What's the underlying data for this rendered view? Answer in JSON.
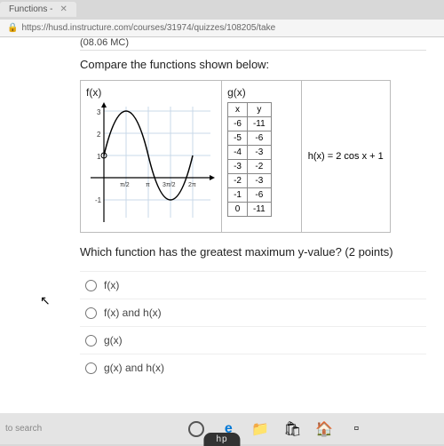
{
  "tab": {
    "title": "Functions - ",
    "close": "✕"
  },
  "urlbar": {
    "lock": "🔒",
    "url": "https://husd.instructure.com/courses/31974/quizzes/108205/take"
  },
  "question_code": "(08.06 MC)",
  "prompt": "Compare the functions shown below:",
  "columns": {
    "fx_label": "f(x)",
    "gx_label": "g(x)",
    "hx_label": "h(x) = 2 cos x + 1"
  },
  "chart_data": {
    "type": "line",
    "title": "",
    "xlabel": "",
    "ylabel": "",
    "xlim": [
      -0.6,
      6.8
    ],
    "ylim": [
      -1.5,
      3.5
    ],
    "xticks": [
      "π/2",
      "π",
      "3π/2",
      "2π"
    ],
    "yticks": [
      1,
      2,
      3
    ],
    "series": [
      {
        "name": "f(x)",
        "x": [
          0,
          0.785,
          1.571,
          2.356,
          3.142,
          3.927,
          4.712,
          5.498,
          6.283
        ],
        "y": [
          1,
          2.414,
          3,
          2.414,
          1,
          -0.414,
          -1,
          -0.414,
          1
        ]
      }
    ]
  },
  "gx_table": {
    "headers": [
      "x",
      "y"
    ],
    "rows": [
      [
        "-6",
        "-11"
      ],
      [
        "-5",
        "-6"
      ],
      [
        "-4",
        "-3"
      ],
      [
        "-3",
        "-2"
      ],
      [
        "-2",
        "-3"
      ],
      [
        "-1",
        "-6"
      ],
      [
        "0",
        "-11"
      ]
    ]
  },
  "question": "Which function has the greatest maximum y-value? (2 points)",
  "options": [
    "f(x)",
    "f(x) and h(x)",
    "g(x)",
    "g(x) and h(x)"
  ],
  "taskbar": {
    "search": "to search",
    "brand": "hp"
  }
}
